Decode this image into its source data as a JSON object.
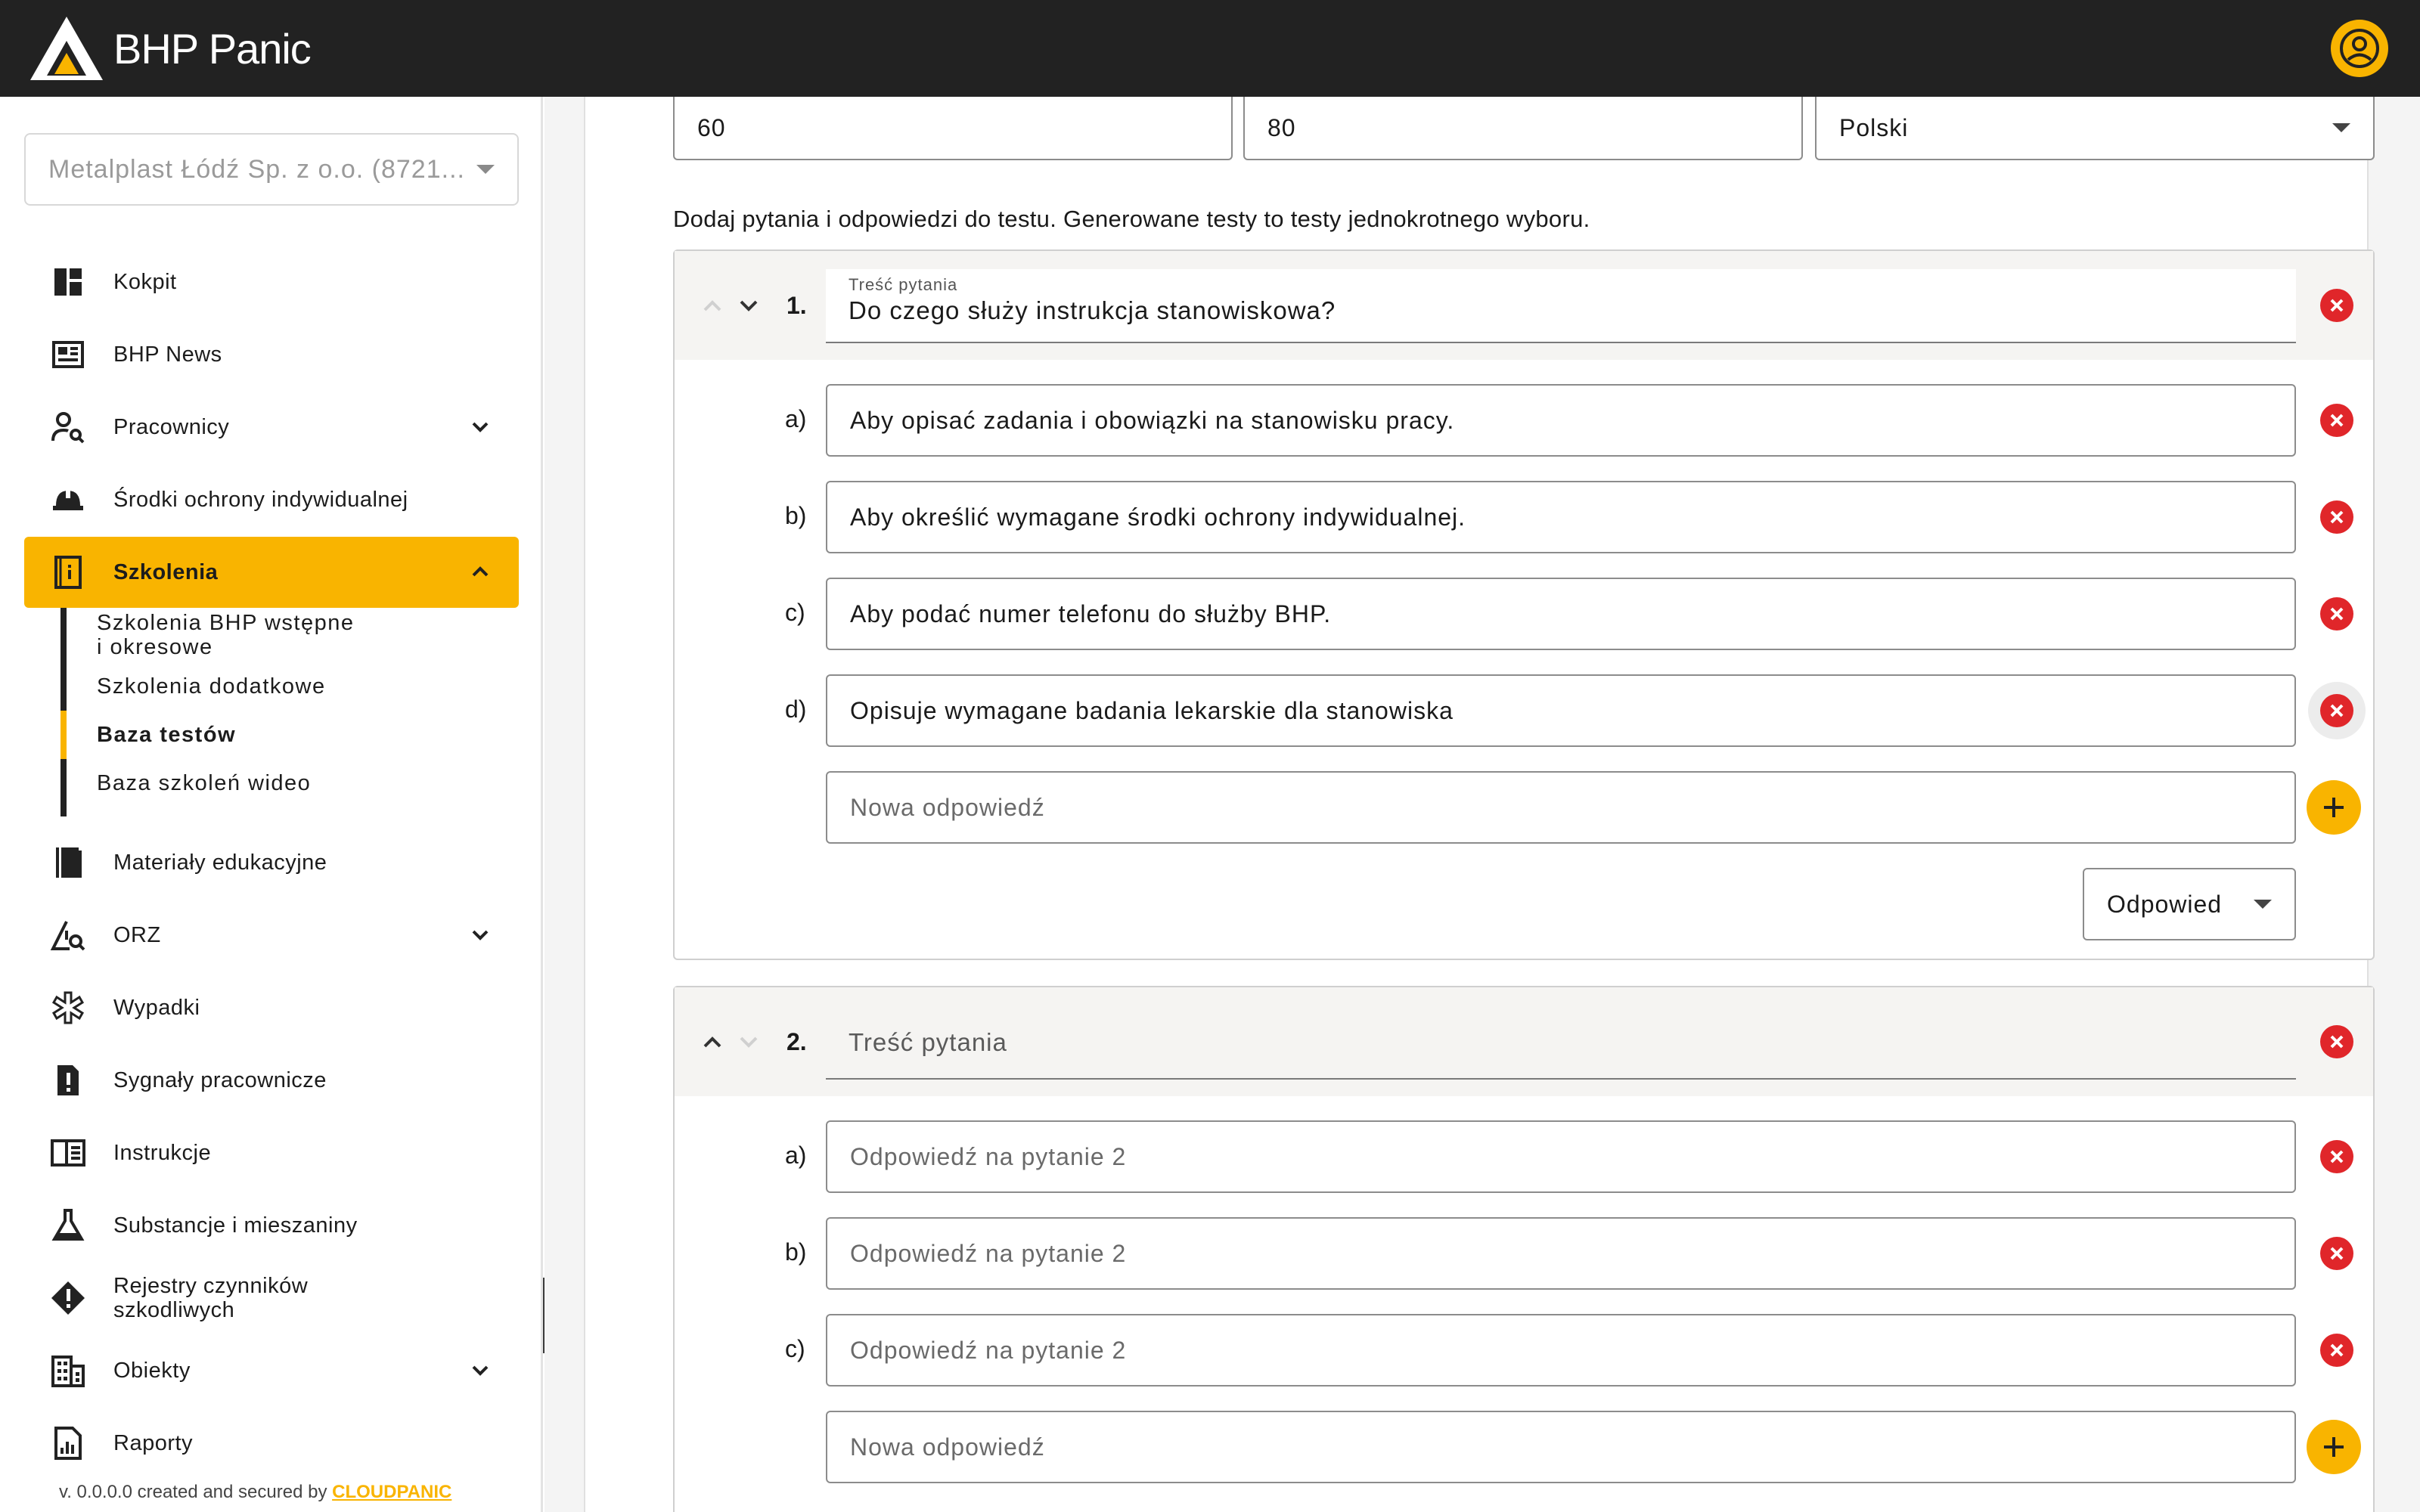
{
  "header": {
    "logo_text": "BHP Panic"
  },
  "sidebar": {
    "company": "Metalplast Łódź Sp. z o.o. (8721...",
    "items": {
      "kokpit": "Kokpit",
      "news": "BHP News",
      "pracownicy": "Pracownicy",
      "srodki": "Środki ochrony indywidualnej",
      "szkolenia": "Szkolenia",
      "materialy": "Materiały edukacyjne",
      "orz": "ORZ",
      "wypadki": "Wypadki",
      "sygnaly": "Sygnały pracownicze",
      "instrukcje": "Instrukcje",
      "substancje": "Substancje i mieszaniny",
      "rejestry_1": "Rejestry czynników",
      "rejestry_2": "szkodliwych",
      "obiekty": "Obiekty",
      "raporty": "Raporty"
    },
    "sub_items": {
      "bhp_1": "Szkolenia BHP wstępne",
      "bhp_2": "i okresowe",
      "dodatkowe": "Szkolenia dodatkowe",
      "testy": "Baza testów",
      "wideo": "Baza szkoleń wideo"
    },
    "footer_prefix": "v. 0.0.0.0 created and secured by ",
    "footer_brand": "CLOUDPANIC"
  },
  "form": {
    "field1_value": "60",
    "field2_value": "80",
    "language_value": "Polski",
    "hint": "Dodaj pytania i odpowiedzi do testu. Generowane testy to testy jednokrotnego wyboru."
  },
  "questions": {
    "q1": {
      "number": "1.",
      "label": "Treść pytania",
      "value": "Do czego służy instrukcja stanowiskowa?",
      "answers": {
        "a": {
          "label": "a)",
          "text": "Aby opisać zadania i obowiązki na stanowisku pracy."
        },
        "b": {
          "label": "b)",
          "text": "Aby określić wymagane środki ochrony indywidualnej."
        },
        "c": {
          "label": "c)",
          "text": "Aby podać numer telefonu do służby BHP."
        },
        "d": {
          "label": "d)",
          "text": "Opisuje wymagane badania lekarskie dla stanowiska"
        }
      },
      "new_answer_placeholder": "Nowa odpowiedź",
      "correct_select": "Odpowied"
    },
    "q2": {
      "number": "2.",
      "placeholder": "Treść pytania",
      "answers": {
        "a": {
          "label": "a)",
          "text": "Odpowiedź na pytanie 2"
        },
        "b": {
          "label": "b)",
          "text": "Odpowiedź na pytanie 2"
        },
        "c": {
          "label": "c)",
          "text": "Odpowiedź na pytanie 2"
        }
      },
      "new_answer_placeholder": "Nowa odpowiedź"
    }
  },
  "colors": {
    "accent": "#f9b400",
    "topbar": "#222222",
    "danger": "#e0262a"
  }
}
